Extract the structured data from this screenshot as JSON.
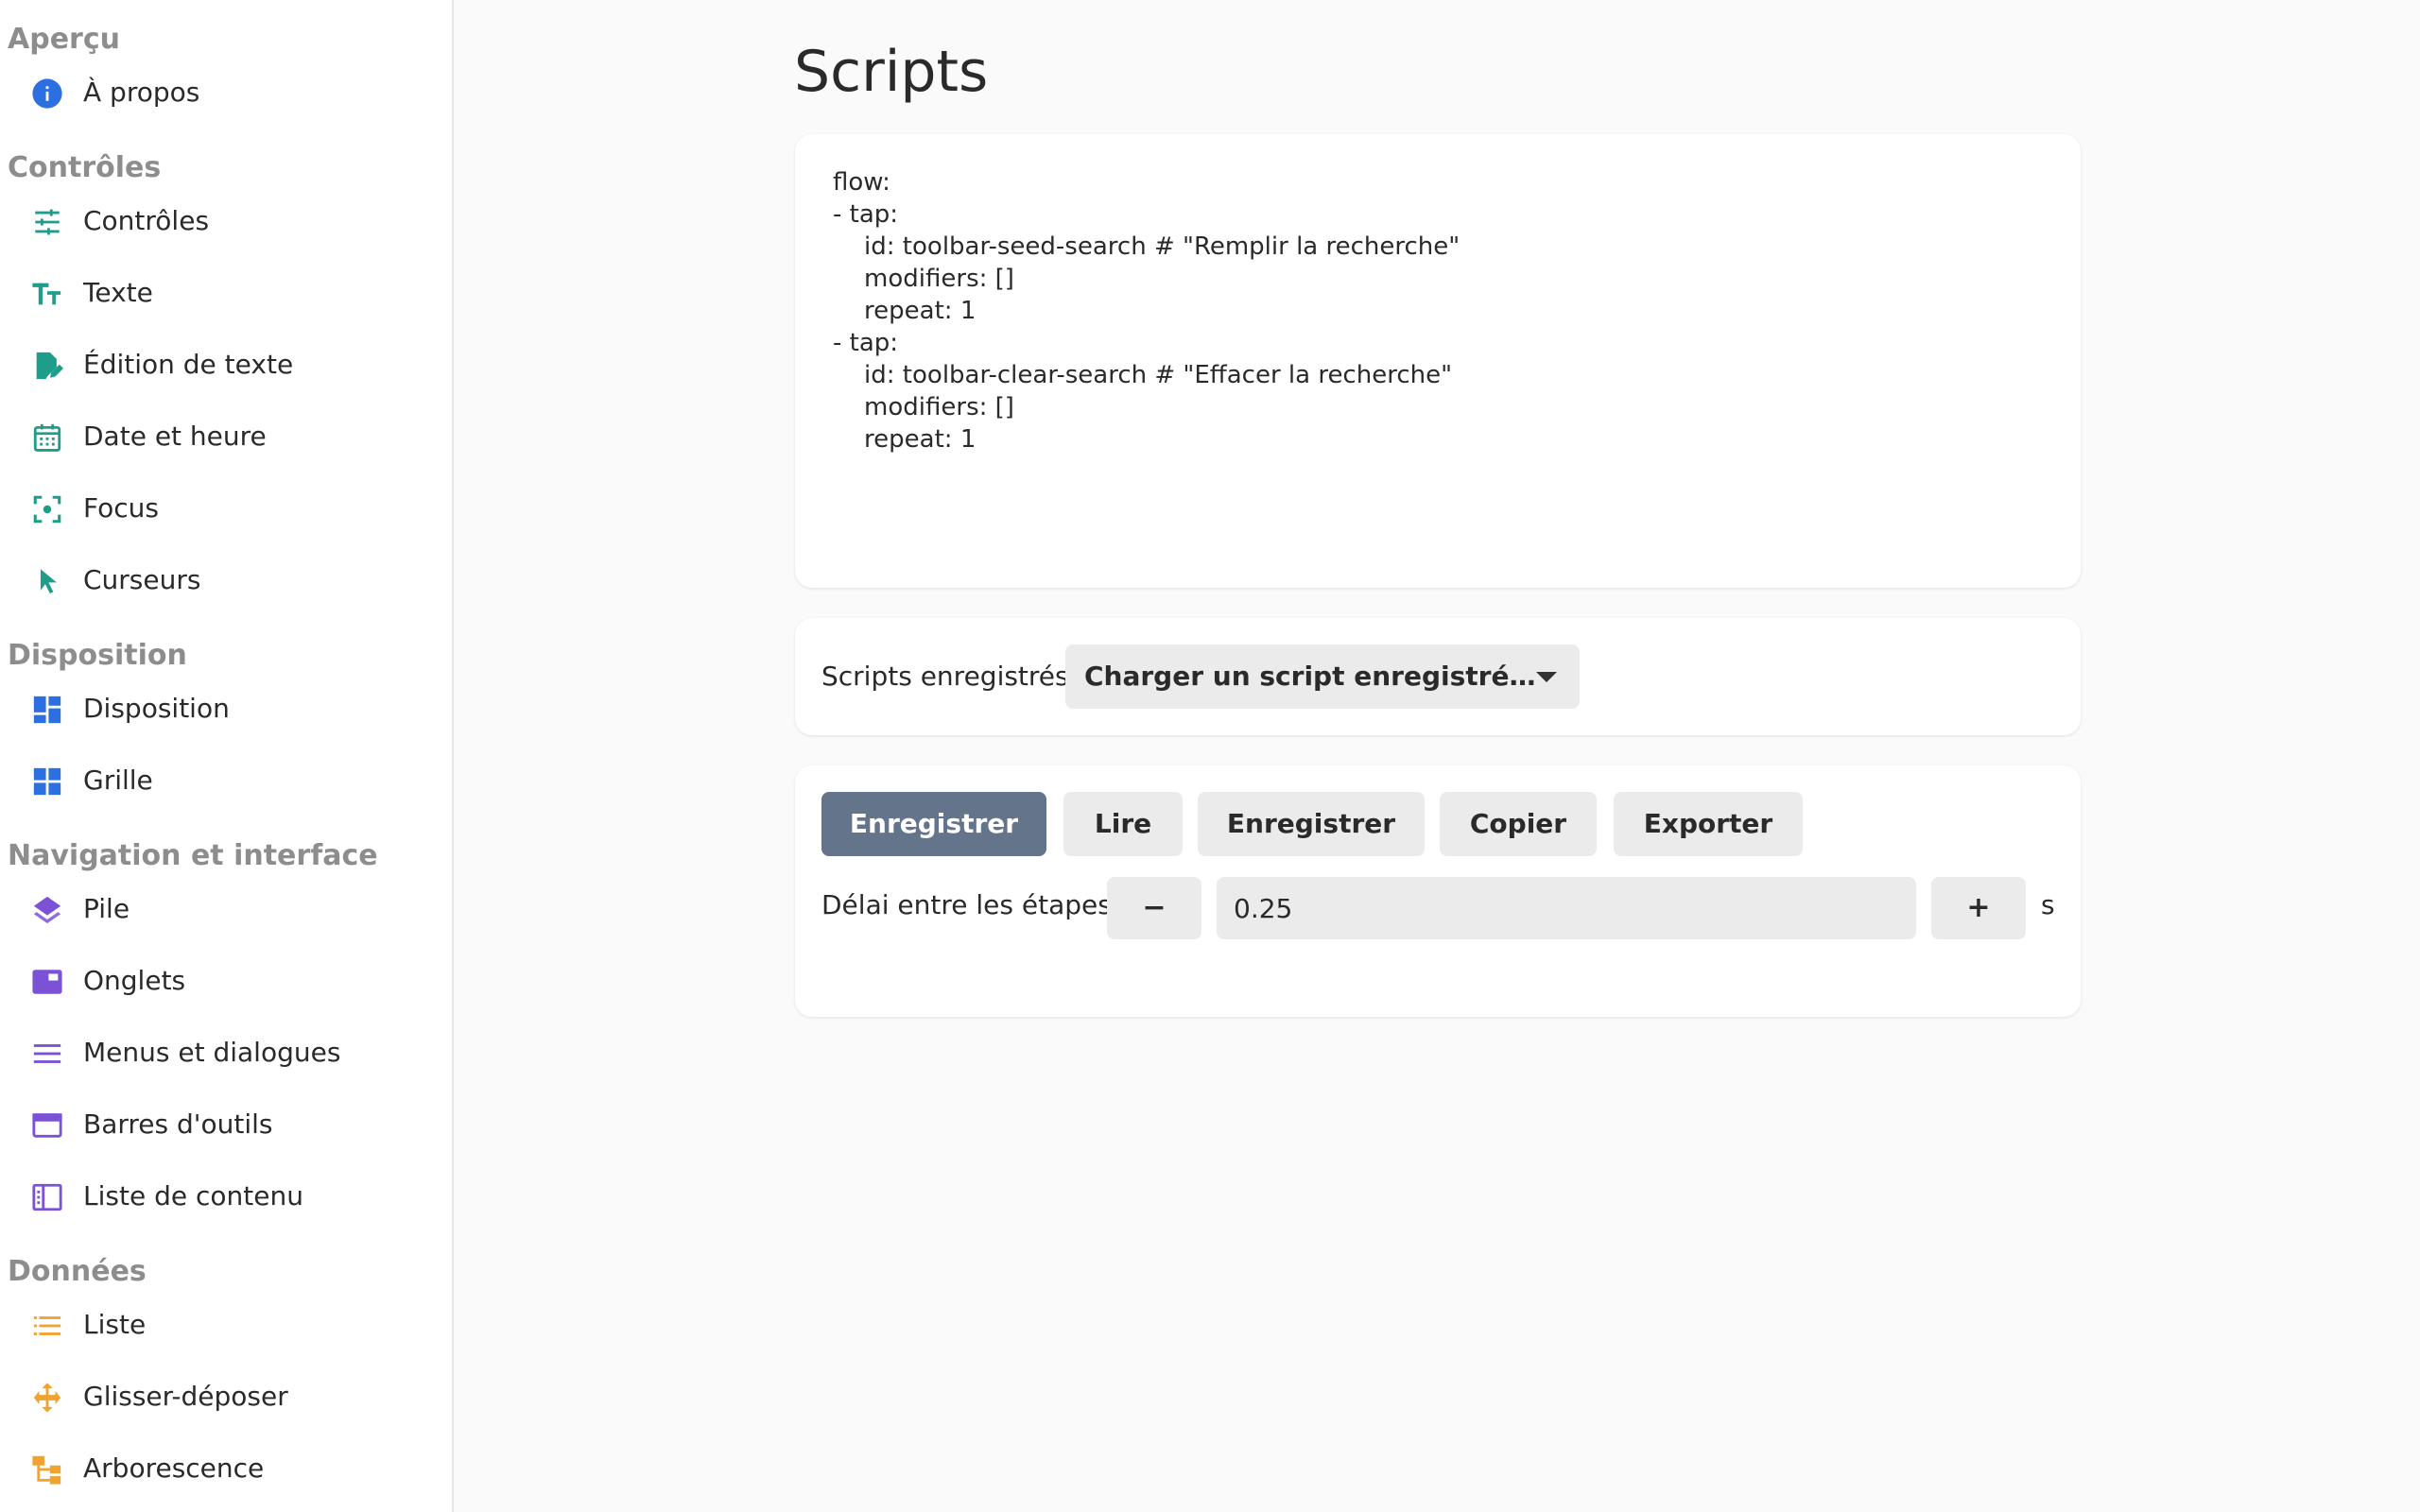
{
  "sidebar": {
    "sections": [
      {
        "title": "Aperçu",
        "items": [
          {
            "label": "À propos",
            "icon": "info-icon",
            "color": "#2c6fe0"
          }
        ]
      },
      {
        "title": "Contrôles",
        "items": [
          {
            "label": "Contrôles",
            "icon": "sliders-icon",
            "color": "#1e9e8a"
          },
          {
            "label": "Texte",
            "icon": "text-format-icon",
            "color": "#1e9e8a"
          },
          {
            "label": "Édition de texte",
            "icon": "edit-document-icon",
            "color": "#1e9e8a"
          },
          {
            "label": "Date et heure",
            "icon": "calendar-icon",
            "color": "#1e9e8a"
          },
          {
            "label": "Focus",
            "icon": "focus-icon",
            "color": "#1e9e8a"
          },
          {
            "label": "Curseurs",
            "icon": "cursor-icon",
            "color": "#1e9e8a"
          }
        ]
      },
      {
        "title": "Disposition",
        "items": [
          {
            "label": "Disposition",
            "icon": "dashboard-layout-icon",
            "color": "#2c6fe0"
          },
          {
            "label": "Grille",
            "icon": "grid-icon",
            "color": "#2c6fe0"
          }
        ]
      },
      {
        "title": "Navigation et interface",
        "items": [
          {
            "label": "Pile",
            "icon": "layers-icon",
            "color": "#7b52d6"
          },
          {
            "label": "Onglets",
            "icon": "tab-icon",
            "color": "#7b52d6"
          },
          {
            "label": "Menus et dialogues",
            "icon": "menu-icon",
            "color": "#7b52d6"
          },
          {
            "label": "Barres d'outils",
            "icon": "window-toolbar-icon",
            "color": "#7b52d6"
          },
          {
            "label": "Liste de contenu",
            "icon": "content-list-icon",
            "color": "#7b52d6"
          }
        ]
      },
      {
        "title": "Données",
        "items": [
          {
            "label": "Liste",
            "icon": "list-icon",
            "color": "#f0a32e"
          },
          {
            "label": "Glisser-déposer",
            "icon": "drag-move-icon",
            "color": "#f0a32e"
          },
          {
            "label": "Arborescence",
            "icon": "tree-icon",
            "color": "#f0a32e"
          }
        ]
      }
    ]
  },
  "main": {
    "title": "Scripts",
    "script_code": "flow:\n- tap:\n    id: toolbar-seed-search # \"Remplir la recherche\"\n    modifiers: []\n    repeat: 1\n- tap:\n    id: toolbar-clear-search # \"Effacer la recherche\"\n    modifiers: []\n    repeat: 1",
    "saved": {
      "label": "Scripts enregistrés",
      "select_value": "Charger un script enregistré…"
    },
    "controls": {
      "buttons": [
        {
          "label": "Enregistrer",
          "primary": true
        },
        {
          "label": "Lire",
          "primary": false
        },
        {
          "label": "Enregistrer",
          "primary": false
        },
        {
          "label": "Copier",
          "primary": false
        },
        {
          "label": "Exporter",
          "primary": false
        }
      ],
      "delay_label": "Délai entre les étapes",
      "decrement_label": "−",
      "increment_label": "+",
      "delay_value": "0.25",
      "unit": "s"
    },
    "accent_color": "#64748b"
  }
}
